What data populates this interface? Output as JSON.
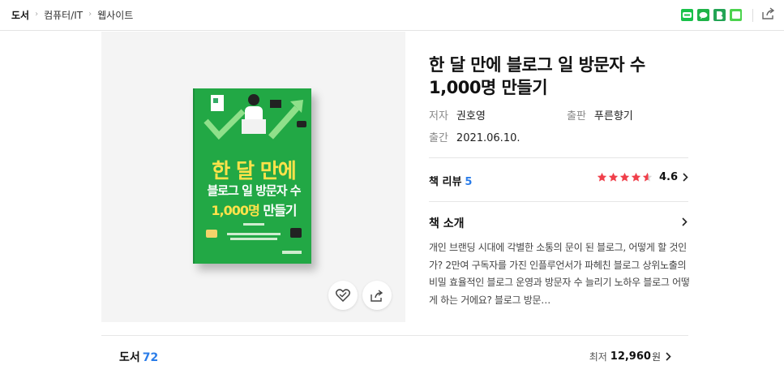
{
  "breadcrumb": [
    "도서",
    "컴퓨터/IT",
    "웹사이트"
  ],
  "book": {
    "title": "한 달 만에 블로그 일 방문자 수 1,000명 만들기",
    "author_label": "저자",
    "author": "권호영",
    "publisher_label": "출판",
    "publisher": "푸른향기",
    "date_label": "출간",
    "date": "2021.06.10."
  },
  "cover": {
    "line1": "한 달 만에",
    "line2": "블로그 일 방문자 수",
    "line3_highlight": "1,000명",
    "line3_rest": " 만들기"
  },
  "review": {
    "label": "책 리뷰",
    "count": "5",
    "rating": "4.6",
    "stars_filled": 4.6
  },
  "intro": {
    "label": "책 소개",
    "text": "개인 브랜딩 시대에 각별한 소통의 문이 된 블로그, 어떻게 할 것인가? 2만여 구독자를 가진 인플루언서가 파헤친 블로그 상위노출의 비밀 효율적인 블로그 운영과 방문자 수 늘리기 노하우 블로그 어떻게 하는 거에요? 블로그 방문…"
  },
  "bottom": {
    "label": "도서",
    "count": "72",
    "price_prefix": "최저",
    "price": "12,960",
    "price_unit": "원"
  },
  "colors": {
    "accent_blue": "#2b7de9",
    "star_red": "#f0404b",
    "cover_green": "#22a845"
  },
  "icons": [
    "chevron-right-icon",
    "blog-share-icon",
    "talk-share-icon",
    "band-share-icon",
    "line-share-icon",
    "share-icon",
    "heart-icon"
  ]
}
